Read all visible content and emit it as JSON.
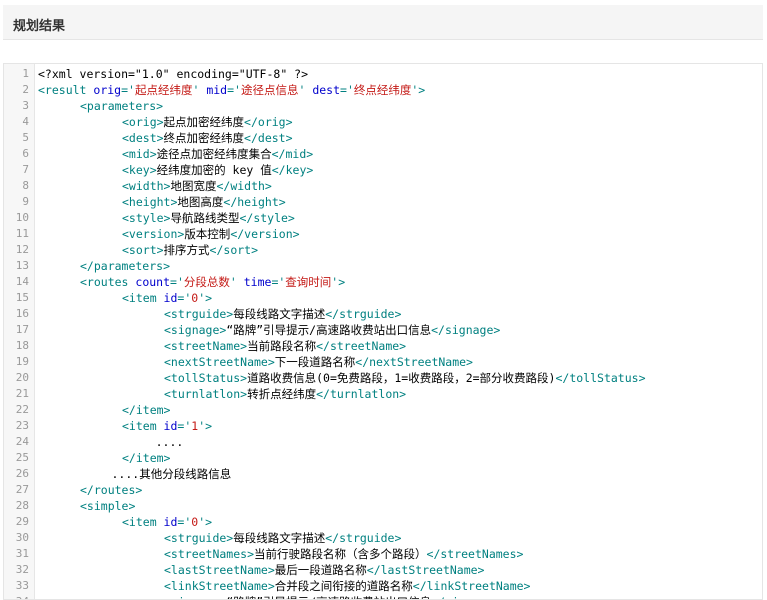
{
  "panel": {
    "title": "规划结果"
  },
  "code": {
    "lines": [
      {
        "n": "1",
        "indent": 0,
        "parts": [
          {
            "t": "<?xml version=\"1.0\" encoding=\"UTF-8\" ?>",
            "c": "txt"
          }
        ]
      },
      {
        "n": "2",
        "indent": 0,
        "parts": [
          {
            "t": "<result ",
            "c": "tag"
          },
          {
            "t": "orig",
            "c": "attr"
          },
          {
            "t": "='",
            "c": "tag"
          },
          {
            "t": "起点经纬度",
            "c": "val"
          },
          {
            "t": "' ",
            "c": "tag"
          },
          {
            "t": "mid",
            "c": "attr"
          },
          {
            "t": "='",
            "c": "tag"
          },
          {
            "t": "途径点信息",
            "c": "val"
          },
          {
            "t": "' ",
            "c": "tag"
          },
          {
            "t": "dest",
            "c": "attr"
          },
          {
            "t": "='",
            "c": "tag"
          },
          {
            "t": "终点经纬度",
            "c": "val"
          },
          {
            "t": "'>",
            "c": "tag"
          }
        ]
      },
      {
        "n": "3",
        "indent": 1,
        "parts": [
          {
            "t": "<parameters>",
            "c": "tag"
          }
        ]
      },
      {
        "n": "4",
        "indent": 2,
        "parts": [
          {
            "t": "<orig>",
            "c": "tag"
          },
          {
            "t": "起点加密经纬度",
            "c": "txt"
          },
          {
            "t": "</orig>",
            "c": "tag"
          }
        ]
      },
      {
        "n": "5",
        "indent": 2,
        "parts": [
          {
            "t": "<dest>",
            "c": "tag"
          },
          {
            "t": "终点加密经纬度",
            "c": "txt"
          },
          {
            "t": "</dest>",
            "c": "tag"
          }
        ]
      },
      {
        "n": "6",
        "indent": 2,
        "parts": [
          {
            "t": "<mid>",
            "c": "tag"
          },
          {
            "t": "途径点加密经纬度集合",
            "c": "txt"
          },
          {
            "t": "</mid>",
            "c": "tag"
          }
        ]
      },
      {
        "n": "7",
        "indent": 2,
        "parts": [
          {
            "t": "<key>",
            "c": "tag"
          },
          {
            "t": "经纬度加密的 key 值",
            "c": "txt"
          },
          {
            "t": "</key>",
            "c": "tag"
          }
        ]
      },
      {
        "n": "8",
        "indent": 2,
        "parts": [
          {
            "t": "<width>",
            "c": "tag"
          },
          {
            "t": "地图宽度",
            "c": "txt"
          },
          {
            "t": "</width>",
            "c": "tag"
          }
        ]
      },
      {
        "n": "9",
        "indent": 2,
        "parts": [
          {
            "t": "<height>",
            "c": "tag"
          },
          {
            "t": "地图高度",
            "c": "txt"
          },
          {
            "t": "</height>",
            "c": "tag"
          }
        ]
      },
      {
        "n": "10",
        "indent": 2,
        "parts": [
          {
            "t": "<style>",
            "c": "tag"
          },
          {
            "t": "导航路线类型",
            "c": "txt"
          },
          {
            "t": "</style>",
            "c": "tag"
          }
        ]
      },
      {
        "n": "11",
        "indent": 2,
        "parts": [
          {
            "t": "<version>",
            "c": "tag"
          },
          {
            "t": "版本控制",
            "c": "txt"
          },
          {
            "t": "</version>",
            "c": "tag"
          }
        ]
      },
      {
        "n": "12",
        "indent": 2,
        "parts": [
          {
            "t": "<sort>",
            "c": "tag"
          },
          {
            "t": "排序方式",
            "c": "txt"
          },
          {
            "t": "</sort>",
            "c": "tag"
          }
        ]
      },
      {
        "n": "13",
        "indent": 1,
        "parts": [
          {
            "t": "</parameters>",
            "c": "tag"
          }
        ]
      },
      {
        "n": "14",
        "indent": 1,
        "parts": [
          {
            "t": "<routes ",
            "c": "tag"
          },
          {
            "t": "count",
            "c": "attr"
          },
          {
            "t": "='",
            "c": "tag"
          },
          {
            "t": "分段总数",
            "c": "val"
          },
          {
            "t": "' ",
            "c": "tag"
          },
          {
            "t": "time",
            "c": "attr"
          },
          {
            "t": "='",
            "c": "tag"
          },
          {
            "t": "查询时间",
            "c": "val"
          },
          {
            "t": "'>",
            "c": "tag"
          }
        ]
      },
      {
        "n": "15",
        "indent": 2,
        "parts": [
          {
            "t": "<item ",
            "c": "tag"
          },
          {
            "t": "id",
            "c": "attr"
          },
          {
            "t": "='",
            "c": "tag"
          },
          {
            "t": "0",
            "c": "val"
          },
          {
            "t": "'>",
            "c": "tag"
          }
        ]
      },
      {
        "n": "16",
        "indent": 3,
        "parts": [
          {
            "t": "<strguide>",
            "c": "tag"
          },
          {
            "t": "每段线路文字描述",
            "c": "txt"
          },
          {
            "t": "</strguide>",
            "c": "tag"
          }
        ]
      },
      {
        "n": "17",
        "indent": 3,
        "parts": [
          {
            "t": "<signage>",
            "c": "tag"
          },
          {
            "t": "“路牌”引导提示/高速路收费站出口信息",
            "c": "txt"
          },
          {
            "t": "</signage>",
            "c": "tag"
          }
        ]
      },
      {
        "n": "18",
        "indent": 3,
        "parts": [
          {
            "t": "<streetName>",
            "c": "tag"
          },
          {
            "t": "当前路段名称",
            "c": "txt"
          },
          {
            "t": "</streetName>",
            "c": "tag"
          }
        ]
      },
      {
        "n": "19",
        "indent": 3,
        "parts": [
          {
            "t": "<nextStreetName>",
            "c": "tag"
          },
          {
            "t": "下一段道路名称",
            "c": "txt"
          },
          {
            "t": "</nextStreetName>",
            "c": "tag"
          }
        ]
      },
      {
        "n": "20",
        "indent": 3,
        "parts": [
          {
            "t": "<tollStatus>",
            "c": "tag"
          },
          {
            "t": "道路收费信息(0=免费路段，1=收费路段，2=部分收费路段)",
            "c": "txt"
          },
          {
            "t": "</tollStatus>",
            "c": "tag"
          }
        ]
      },
      {
        "n": "21",
        "indent": 3,
        "parts": [
          {
            "t": "<turnlatlon>",
            "c": "tag"
          },
          {
            "t": "转折点经纬度",
            "c": "txt"
          },
          {
            "t": "</turnlatlon>",
            "c": "tag"
          }
        ]
      },
      {
        "n": "22",
        "indent": 2,
        "parts": [
          {
            "t": "</item>",
            "c": "tag"
          }
        ]
      },
      {
        "n": "23",
        "indent": 2,
        "parts": [
          {
            "t": "<item ",
            "c": "tag"
          },
          {
            "t": "id",
            "c": "attr"
          },
          {
            "t": "='",
            "c": "tag"
          },
          {
            "t": "1",
            "c": "val"
          },
          {
            "t": "'>",
            "c": "tag"
          }
        ]
      },
      {
        "n": "24",
        "indent": 2.8,
        "parts": [
          {
            "t": "....",
            "c": "txt"
          }
        ]
      },
      {
        "n": "25",
        "indent": 2,
        "parts": [
          {
            "t": "</item>",
            "c": "tag"
          }
        ]
      },
      {
        "n": "26",
        "indent": 1.75,
        "parts": [
          {
            "t": "....其他分段线路信息",
            "c": "txt"
          }
        ]
      },
      {
        "n": "27",
        "indent": 1,
        "parts": [
          {
            "t": "</routes>",
            "c": "tag"
          }
        ]
      },
      {
        "n": "28",
        "indent": 1,
        "parts": [
          {
            "t": "<simple>",
            "c": "tag"
          }
        ]
      },
      {
        "n": "29",
        "indent": 2,
        "parts": [
          {
            "t": "<item ",
            "c": "tag"
          },
          {
            "t": "id",
            "c": "attr"
          },
          {
            "t": "='",
            "c": "tag"
          },
          {
            "t": "0",
            "c": "val"
          },
          {
            "t": "'>",
            "c": "tag"
          }
        ]
      },
      {
        "n": "30",
        "indent": 3,
        "parts": [
          {
            "t": "<strguide>",
            "c": "tag"
          },
          {
            "t": "每段线路文字描述",
            "c": "txt"
          },
          {
            "t": "</strguide>",
            "c": "tag"
          }
        ]
      },
      {
        "n": "31",
        "indent": 3,
        "parts": [
          {
            "t": "<streetNames>",
            "c": "tag"
          },
          {
            "t": "当前行驶路段名称（含多个路段）",
            "c": "txt"
          },
          {
            "t": "</streetNames>",
            "c": "tag"
          }
        ]
      },
      {
        "n": "32",
        "indent": 3,
        "parts": [
          {
            "t": "<lastStreetName>",
            "c": "tag"
          },
          {
            "t": "最后一段道路名称",
            "c": "txt"
          },
          {
            "t": "</lastStreetName>",
            "c": "tag"
          }
        ]
      },
      {
        "n": "33",
        "indent": 3,
        "parts": [
          {
            "t": "<linkStreetName>",
            "c": "tag"
          },
          {
            "t": "合并段之间衔接的道路名称",
            "c": "txt"
          },
          {
            "t": "</linkStreetName>",
            "c": "tag"
          }
        ]
      },
      {
        "n": "34",
        "indent": 3,
        "parts": [
          {
            "t": "<signage>",
            "c": "tag"
          },
          {
            "t": "“路牌”引导提示/高速路收费站出口信息",
            "c": "txt"
          },
          {
            "t": "</signage>",
            "c": "tag"
          }
        ]
      }
    ]
  }
}
